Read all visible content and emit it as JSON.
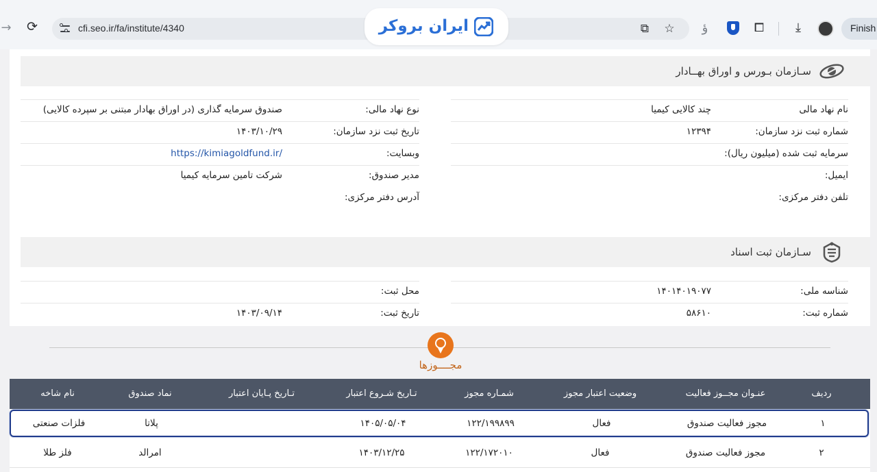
{
  "browser": {
    "url": "cfi.seo.ir/fa/institute/4340",
    "finish_label": "Finish",
    "overlay_logo_text": "ایران بروکر"
  },
  "exchange_section": {
    "title": "سـازمان بـورس و اوراق بهــادار",
    "right_fields": [
      {
        "label": "نام نهاد مالی",
        "value": "چند کالایی کیمیا"
      },
      {
        "label": "شماره ثبت نزد سازمان:",
        "value": "۱۲۳۹۴"
      },
      {
        "label": "سرمایه ثبت شده (میلیون ریال):",
        "value": ""
      },
      {
        "label": "ایمیل:",
        "value": ""
      },
      {
        "label": "تلفن دفتر مرکزی:",
        "value": ""
      }
    ],
    "left_fields": [
      {
        "label": "نوع نهاد مالی:",
        "value": "صندوق سرمایه گذاری (در اوراق بهادار مبتنی بر سپرده کالایی)"
      },
      {
        "label": "تاریخ ثبت نزد سازمان:",
        "value": "۱۴۰۳/۱۰/۲۹"
      },
      {
        "label": "وبسایت:",
        "value": "https://kimiagoldfund.ir/"
      },
      {
        "label": "مدیر صندوق:",
        "value": "شرکت تامین سرمایه کیمیا"
      },
      {
        "label": "آدرس دفتر مرکزی:",
        "value": ""
      }
    ]
  },
  "registry_section": {
    "title": "سـازمان ثبت اسناد",
    "right_fields": [
      {
        "label": "شناسه ملی:",
        "value": "۱۴۰۱۴۰۱۹۰۷۷"
      },
      {
        "label": "شماره ثبت:",
        "value": "۵۸۶۱۰"
      }
    ],
    "left_fields": [
      {
        "label": "محل ثبت:",
        "value": ""
      },
      {
        "label": "تاریخ ثبت:",
        "value": "۱۴۰۳/۰۹/۱۴"
      }
    ]
  },
  "licenses": {
    "title": "مجــــوزها",
    "columns": [
      "ردیف",
      "عنـوان مجــوز فعالیت",
      "وضعیت اعتبار مجوز",
      "شمـاره مجوز",
      "تـاریخ شـروع اعتبار",
      "تـاریخ پـایان اعتبار",
      "نماد صندوق",
      "نام شاخه"
    ],
    "rows": [
      [
        "۱",
        "مجوز فعالیت صندوق",
        "فعال",
        "۱۲۲/۱۹۹۸۹۹",
        "۱۴۰۵/۰۵/۰۴",
        "",
        "پلاتا",
        "فلزات صنعتی"
      ],
      [
        "۲",
        "مجوز فعالیت صندوق",
        "فعال",
        "۱۲۲/۱۷۲۰۱۰",
        "۱۴۰۳/۱۲/۲۵",
        "",
        "امرالد",
        "فلز طلا"
      ]
    ]
  },
  "icons": {
    "forward": "arrow-forward-icon",
    "reload": "reload-icon",
    "site_info": "tune-icon",
    "translate": "translate-icon",
    "bookmark": "star-icon",
    "extension": "puzzle-icon",
    "download": "download-icon",
    "exchange_logo": "seo-logo-icon",
    "registry_logo": "registry-emblem-icon",
    "licenses": "award-icon"
  },
  "colors": {
    "table_header": "#4d5666",
    "accent_orange": "#e8751c",
    "selected_row_border": "#1f3b8c",
    "link": "#2456a8",
    "brand_blue": "#2b6fd6"
  }
}
